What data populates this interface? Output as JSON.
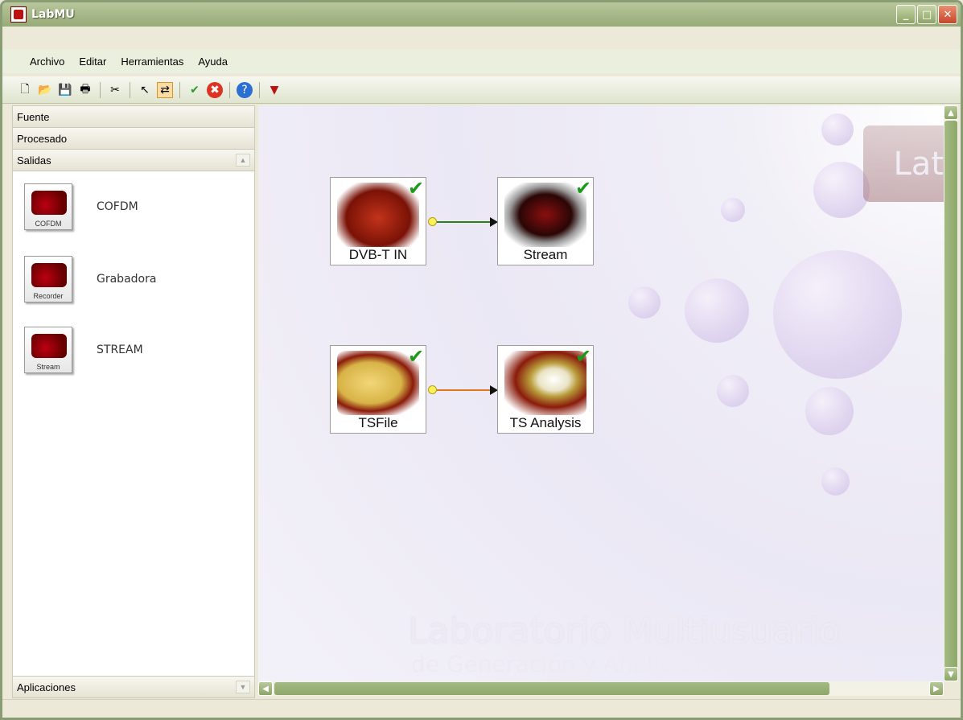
{
  "window": {
    "title": "LabMU",
    "minimize": "_",
    "maximize": "□",
    "close": "✕"
  },
  "menu": [
    {
      "label": "Archivo"
    },
    {
      "label": "Editar"
    },
    {
      "label": "Herramientas"
    },
    {
      "label": "Ayuda"
    }
  ],
  "toolbar": {
    "new": "🗋",
    "open": "📂",
    "save": "💾",
    "print": "🖶",
    "cut": "✂",
    "select": "↖",
    "connect": "⇄",
    "ok": "✔",
    "stop": "✖",
    "help": "?",
    "app": "▼"
  },
  "sidebar": {
    "groups": [
      "Fuente",
      "Procesado",
      "Salidas"
    ],
    "items": [
      {
        "label": "COFDM",
        "caption": "COFDM",
        "icon": "cofdm-icon"
      },
      {
        "label": "Grabadora",
        "caption": "Recorder",
        "icon": "recorder-icon"
      },
      {
        "label": "STREAM",
        "caption": "Stream",
        "icon": "stream-icon"
      }
    ],
    "bottom_group": "Aplicaciones"
  },
  "canvas": {
    "nodes": [
      {
        "label": "DVB-T IN",
        "icon": "antenna-icon",
        "color": "#2e7d1e"
      },
      {
        "label": "Stream",
        "icon": "monitor-icon",
        "color": "#2e7d1e"
      },
      {
        "label": "TSFile",
        "icon": "folder-icon",
        "color": "#e0761c"
      },
      {
        "label": "TS Analysis",
        "icon": "stopwatch-icon",
        "color": "#e0761c"
      }
    ],
    "watermark_line1": "Laboratorio Multiusuario",
    "watermark_line2": "de Generación y Análisis de TV Digital Te",
    "logo_text": "Lat"
  },
  "colors": {
    "titlebar": "#a8b98a",
    "link_green": "#2e7d1e",
    "link_orange": "#e0761c"
  }
}
